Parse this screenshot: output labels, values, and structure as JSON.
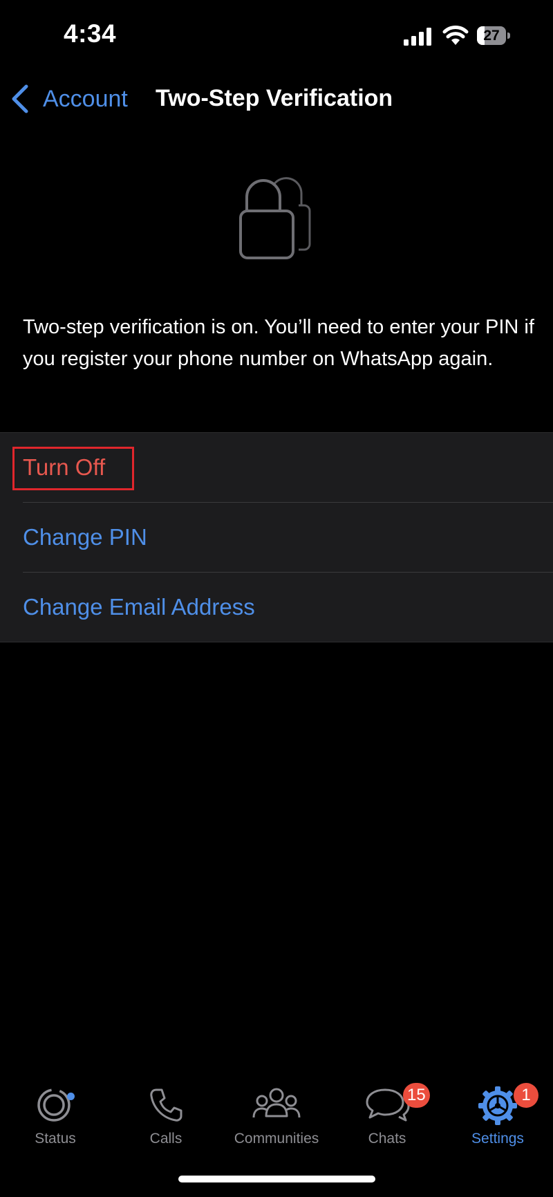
{
  "status_bar": {
    "time": "4:34",
    "battery_level": "27",
    "battery_fraction": 0.27
  },
  "nav": {
    "back_label": "Account",
    "title": "Two-Step Verification"
  },
  "description": "Two-step verification is on. You’ll need to enter your PIN if you register your phone number on WhatsApp again.",
  "options": [
    {
      "label": "Turn Off",
      "color": "#e8584f",
      "highlighted": true
    },
    {
      "label": "Change PIN",
      "color": "#4f8fe8"
    },
    {
      "label": "Change Email Address",
      "color": "#4f8fe8"
    }
  ],
  "tabs": [
    {
      "label": "Status",
      "icon": "status-icon",
      "dot": true
    },
    {
      "label": "Calls",
      "icon": "phone-icon"
    },
    {
      "label": "Communities",
      "icon": "communities-icon"
    },
    {
      "label": "Chats",
      "icon": "chats-icon",
      "badge": "15"
    },
    {
      "label": "Settings",
      "icon": "gear-icon",
      "badge": "1",
      "active": true
    }
  ],
  "colors": {
    "accent": "#4f8fe8",
    "destructive": "#e8584f",
    "badge": "#eb4d3d",
    "highlight_box": "#e0262c",
    "list_background": "#1c1c1e"
  }
}
